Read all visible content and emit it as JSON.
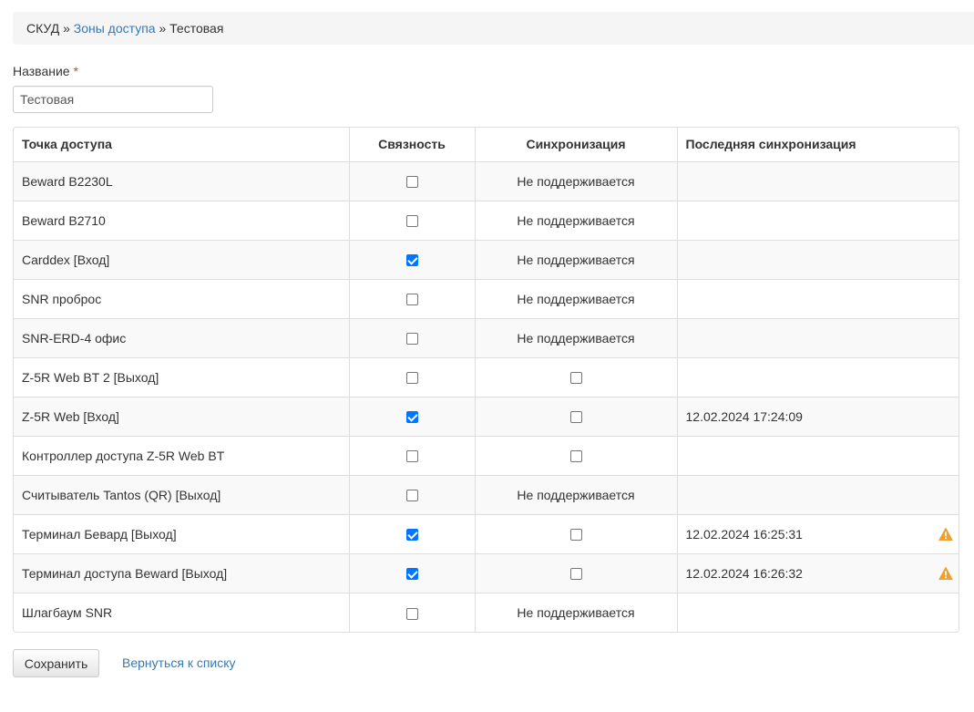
{
  "breadcrumb": {
    "root": "СКУД",
    "separator": "»",
    "parent": "Зоны доступа",
    "current": "Тестовая"
  },
  "form": {
    "name_label": "Название",
    "required_mark": "*",
    "name_value": "Тестовая"
  },
  "table": {
    "headers": [
      "Точка доступа",
      "Связность",
      "Синхронизация",
      "Последняя синхронизация"
    ],
    "rows": [
      {
        "name": "Beward B2230L",
        "linked": false,
        "sync": "Не поддерживается",
        "last_sync": "",
        "warning": false
      },
      {
        "name": "Beward B2710",
        "linked": false,
        "sync": "Не поддерживается",
        "last_sync": "",
        "warning": false
      },
      {
        "name": "Carddex [Вход]",
        "linked": true,
        "sync": "Не поддерживается",
        "last_sync": "",
        "warning": false
      },
      {
        "name": "SNR проброс",
        "linked": false,
        "sync": "Не поддерживается",
        "last_sync": "",
        "warning": false
      },
      {
        "name": "SNR-ERD-4 офис",
        "linked": false,
        "sync": "Не поддерживается",
        "last_sync": "",
        "warning": false
      },
      {
        "name": "Z-5R Web BT 2 [Выход]",
        "linked": false,
        "sync": false,
        "last_sync": "",
        "warning": false
      },
      {
        "name": "Z-5R Web [Вход]",
        "linked": true,
        "sync": false,
        "last_sync": "12.02.2024 17:24:09",
        "warning": false
      },
      {
        "name": "Контроллер доступа Z-5R Web BT",
        "linked": false,
        "sync": false,
        "last_sync": "",
        "warning": false
      },
      {
        "name": "Считыватель Tantos (QR) [Выход]",
        "linked": false,
        "sync": "Не поддерживается",
        "last_sync": "",
        "warning": false
      },
      {
        "name": "Терминал Бевард [Выход]",
        "linked": true,
        "sync": false,
        "last_sync": "12.02.2024 16:25:31",
        "warning": true
      },
      {
        "name": "Терминал доступа Beward [Выход]",
        "linked": true,
        "sync": false,
        "last_sync": "12.02.2024 16:26:32",
        "warning": true
      },
      {
        "name": "Шлагбаум SNR",
        "linked": false,
        "sync": "Не поддерживается",
        "last_sync": "",
        "warning": false
      }
    ]
  },
  "actions": {
    "save_label": "Сохранить",
    "back_label": "Вернуться к списку"
  },
  "colors": {
    "link": "#337ab7",
    "checkbox_checked": "#0075ff",
    "warning": "#f0a030",
    "required": "#e0392b"
  },
  "icons": {
    "warning": "warning-triangle-icon"
  }
}
